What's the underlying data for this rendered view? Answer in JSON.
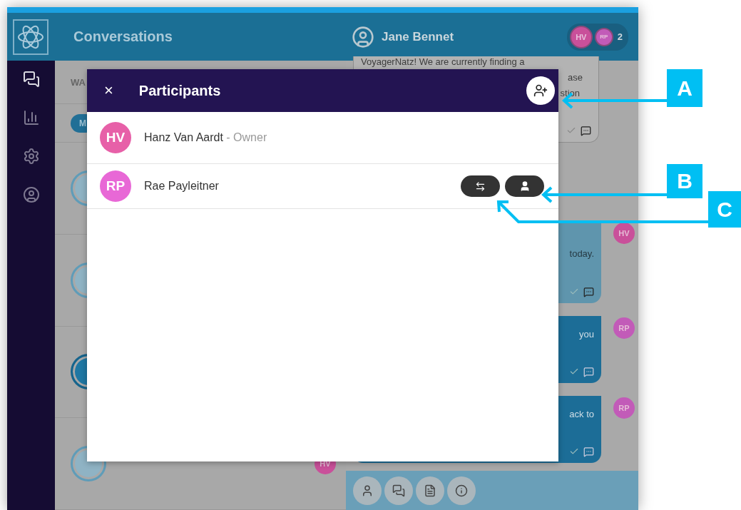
{
  "app": {
    "title": "Conversations",
    "user": "Jane Bennet",
    "participants_badge": {
      "avatars": [
        {
          "initials": "HV",
          "color": "#c9509a"
        },
        {
          "initials": "RP",
          "color": "#c25bb8"
        }
      ],
      "count": "2"
    }
  },
  "conversation_list": {
    "header": "WA",
    "filter_chip": "M",
    "rows": [
      {
        "selected": false
      },
      {
        "selected": false
      },
      {
        "selected": true
      },
      {
        "selected": false
      }
    ],
    "last_sender": {
      "initials": "HV",
      "color": "#c9509a"
    }
  },
  "chat": {
    "messages": [
      {
        "kind": "incoming",
        "lines": [
          "VoyagerNatz! We are currently finding a",
          "ase",
          "stion"
        ]
      },
      {
        "kind": "light",
        "lines": [
          "today."
        ],
        "avatar": {
          "initials": "HV",
          "color": "#c9509a"
        }
      },
      {
        "kind": "dark",
        "lines": [
          "you"
        ],
        "avatar": {
          "initials": "RP",
          "color": "#c25bb8"
        }
      },
      {
        "kind": "dark",
        "lines": [
          "ack to"
        ],
        "avatar": {
          "initials": "RP",
          "color": "#c25bb8"
        }
      }
    ]
  },
  "dialog": {
    "title": "Participants",
    "close": "×",
    "participants": [
      {
        "initials": "HV",
        "color": "#e760a8",
        "name": "Hanz Van Aardt",
        "role": "- Owner",
        "actions": false
      },
      {
        "initials": "RP",
        "color": "#e868d6",
        "name": "Rae Payleitner",
        "actions": true
      }
    ]
  },
  "callouts": [
    {
      "label": "A"
    },
    {
      "label": "B"
    },
    {
      "label": "C"
    }
  ]
}
